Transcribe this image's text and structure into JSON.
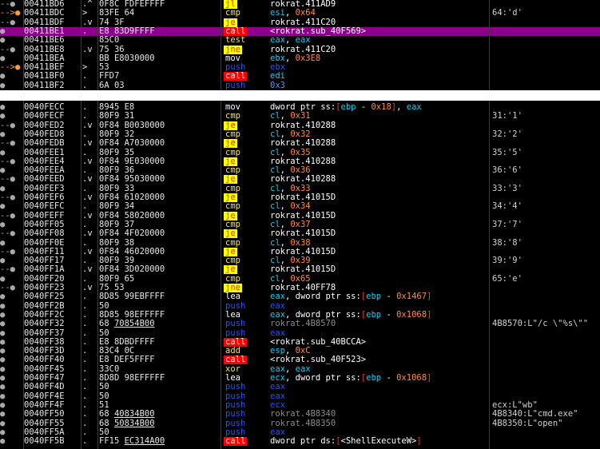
{
  "colors": {
    "call_bg": "#ff0000",
    "jcc_bg": "#ffff00",
    "push_fg": "#2255ff",
    "selected_bg": "#8b008b",
    "highlight_bg": "#00366b"
  },
  "top_rows": [
    {
      "mark": "--●",
      "addr": "00411BD6",
      "flag": ".^",
      "hex": "0F8C FDFEFFFF",
      "mn": "jl",
      "mn_style": "jcc",
      "op": "rokrat.411AD9",
      "comment": ""
    },
    {
      "mark": "-->●",
      "addr": "00411BDC",
      "flag": ">",
      "hex": "83FE 64",
      "mn": "cmp",
      "mn_style": "yellow",
      "op": "esi, 0x64",
      "comment": "64:'d'"
    },
    {
      "mark": "--●",
      "addr": "00411BDF",
      "flag": ".v",
      "hex": "74 3F",
      "mn": "je",
      "mn_style": "jcc",
      "op": "rokrat.411C20",
      "comment": ""
    },
    {
      "mark": "●",
      "addr": "00411BE1",
      "flag": ".",
      "hex": "E8 83D9FFFF",
      "mn": "call",
      "mn_style": "call",
      "op": "<rokrat.sub_40F569>",
      "comment": "",
      "row": "sel"
    },
    {
      "mark": "●",
      "addr": "00411BE6",
      "flag": "",
      "hex": "85C0",
      "mn": "test",
      "mn_style": "yellow",
      "op": "eax, eax",
      "comment": ""
    },
    {
      "mark": "--●",
      "addr": "00411BE8",
      "flag": ".v",
      "hex": "75 36",
      "mn": "jne",
      "mn_style": "jcc",
      "op": "rokrat.411C20",
      "comment": ""
    },
    {
      "mark": "●",
      "addr": "00411BEA",
      "flag": "",
      "hex": "BB E8030000",
      "mn": "mov",
      "mn_style": "plain",
      "op": "ebx, 0x3E8",
      "comment": ""
    },
    {
      "mark": "-->●",
      "addr": "00411BEF",
      "flag": ">",
      "hex": "53",
      "mn": "push",
      "mn_style": "push",
      "op": "ebx",
      "comment": ""
    },
    {
      "mark": "●",
      "addr": "00411BF0",
      "flag": ".",
      "hex": "FFD7",
      "mn": "call",
      "mn_style": "call",
      "op": "edi",
      "comment": ""
    },
    {
      "mark": "●",
      "addr": "00411BF2",
      "flag": ".",
      "hex": "6A 03",
      "mn": "push",
      "mn_style": "push",
      "op": "0x3",
      "comment": ""
    }
  ],
  "bottom_rows": [
    {
      "mark": "●",
      "addr": "0040FECC",
      "flag": ".",
      "hex": "8945 E8",
      "mn": "mov",
      "mn_style": "plain",
      "op": "dword ptr ss:[ebp - 0x18], eax",
      "comment": ""
    },
    {
      "mark": "●",
      "addr": "0040FECF",
      "flag": ".",
      "hex": "80F9 31",
      "mn": "cmp",
      "mn_style": "yellow",
      "op": "cl, 0x31",
      "comment": "31:'1'"
    },
    {
      "mark": "--●",
      "addr": "0040FED2",
      "flag": ".v",
      "hex": "0F84 B0030000",
      "mn": "je",
      "mn_style": "jcc",
      "op": "rokrat.410288",
      "comment": ""
    },
    {
      "mark": "●",
      "addr": "0040FED8",
      "flag": ".",
      "hex": "80F9 32",
      "mn": "cmp",
      "mn_style": "yellow",
      "op": "cl, 0x32",
      "comment": "32:'2'"
    },
    {
      "mark": "--●",
      "addr": "0040FEDB",
      "flag": ".v",
      "hex": "0F84 A7030000",
      "mn": "je",
      "mn_style": "jcc",
      "op": "rokrat.410288",
      "comment": ""
    },
    {
      "mark": "●",
      "addr": "0040FEE1",
      "flag": ".",
      "hex": "80F9 35",
      "mn": "cmp",
      "mn_style": "yellow",
      "op": "cl, 0x35",
      "comment": "35:'5'"
    },
    {
      "mark": "--●",
      "addr": "0040FEE4",
      "flag": ".v",
      "hex": "0F84 9E030000",
      "mn": "je",
      "mn_style": "jcc",
      "op": "rokrat.410288",
      "comment": ""
    },
    {
      "mark": "●",
      "addr": "0040FEEA",
      "flag": ".",
      "hex": "80F9 36",
      "mn": "cmp",
      "mn_style": "yellow",
      "op": "cl, 0x36",
      "comment": "36:'6'"
    },
    {
      "mark": "--●",
      "addr": "0040FEED",
      "flag": ".v",
      "hex": "0F84 95030000",
      "mn": "je",
      "mn_style": "jcc",
      "op": "rokrat.410288",
      "comment": ""
    },
    {
      "mark": "●",
      "addr": "0040FEF3",
      "flag": ".",
      "hex": "80F9 33",
      "mn": "cmp",
      "mn_style": "yellow",
      "op": "cl, 0x33",
      "comment": "33:'3'"
    },
    {
      "mark": "--●",
      "addr": "0040FEF6",
      "flag": ".v",
      "hex": "0F84 61020000",
      "mn": "je",
      "mn_style": "jcc",
      "op": "rokrat.41015D",
      "comment": ""
    },
    {
      "mark": "●",
      "addr": "0040FEFC",
      "flag": ".",
      "hex": "80F9 34",
      "mn": "cmp",
      "mn_style": "yellow",
      "op": "cl, 0x34",
      "comment": "34:'4'"
    },
    {
      "mark": "--●",
      "addr": "0040FEFF",
      "flag": ".v",
      "hex": "0F84 58020000",
      "mn": "je",
      "mn_style": "jcc",
      "op": "rokrat.41015D",
      "comment": ""
    },
    {
      "mark": "●",
      "addr": "0040FF05",
      "flag": ".",
      "hex": "80F9 37",
      "mn": "cmp",
      "mn_style": "yellow",
      "op": "cl, 0x37",
      "comment": "37:'7'"
    },
    {
      "mark": "--●",
      "addr": "0040FF08",
      "flag": ".v",
      "hex": "0F84 4F020000",
      "mn": "je",
      "mn_style": "jcc",
      "op": "rokrat.41015D",
      "comment": ""
    },
    {
      "mark": "●",
      "addr": "0040FF0E",
      "flag": ".",
      "hex": "80F9 38",
      "mn": "cmp",
      "mn_style": "yellow",
      "op": "cl, 0x38",
      "comment": "38:'8'"
    },
    {
      "mark": "--●",
      "addr": "0040FF11",
      "flag": ".v",
      "hex": "0F84 46020000",
      "mn": "je",
      "mn_style": "jcc",
      "op": "rokrat.41015D",
      "comment": ""
    },
    {
      "mark": "●",
      "addr": "0040FF17",
      "flag": ".",
      "hex": "80F9 39",
      "mn": "cmp",
      "mn_style": "yellow",
      "op": "cl, 0x39",
      "comment": "39:'9'"
    },
    {
      "mark": "--●",
      "addr": "0040FF1A",
      "flag": ".v",
      "hex": "0F84 3D020000",
      "mn": "je",
      "mn_style": "jcc",
      "op": "rokrat.41015D",
      "comment": ""
    },
    {
      "mark": "●",
      "addr": "0040FF20",
      "flag": ".",
      "hex": "80F9 65",
      "mn": "cmp",
      "mn_style": "yellow",
      "op": "cl, 0x65",
      "comment": "65:'e'"
    },
    {
      "mark": "--●",
      "addr": "0040FF23",
      "flag": ".v",
      "hex": "75 53",
      "mn": "jne",
      "mn_style": "jcc",
      "op": "rokrat.40FF78",
      "comment": ""
    },
    {
      "mark": "●",
      "addr": "0040FF25",
      "flag": ".",
      "hex": "8D85 99EBFFFF",
      "mn": "lea",
      "mn_style": "plain",
      "op": "eax, dword ptr ss:[ebp - 0x1467]",
      "comment": ""
    },
    {
      "mark": "●",
      "addr": "0040FF2B",
      "flag": ".",
      "hex": "50",
      "mn": "push",
      "mn_style": "push",
      "op": "eax",
      "comment": ""
    },
    {
      "mark": "●",
      "addr": "0040FF2C",
      "flag": ".",
      "hex": "8D85 98EFFFFF",
      "mn": "lea",
      "mn_style": "plain",
      "op": "eax, dword ptr ss:[ebp - 0x1068]",
      "comment": ""
    },
    {
      "mark": "●",
      "addr": "0040FF32",
      "flag": ".",
      "hex": "68 70854B00",
      "mn": "push",
      "mn_style": "push",
      "op": "rokrat.4B8570",
      "comment": "4B8570:L\"/c \\\"%s\\\"\"",
      "hex_under": "70854B00"
    },
    {
      "mark": "●",
      "addr": "0040FF37",
      "flag": ".",
      "hex": "50",
      "mn": "push",
      "mn_style": "push",
      "op": "eax",
      "comment": ""
    },
    {
      "mark": "●",
      "addr": "0040FF38",
      "flag": ".",
      "hex": "E8 8DBDFFFF",
      "mn": "call",
      "mn_style": "call",
      "op": "<rokrat.sub_40BCCA>",
      "comment": ""
    },
    {
      "mark": "●",
      "addr": "0040FF3D",
      "flag": ".",
      "hex": "83C4 0C",
      "mn": "add",
      "mn_style": "yellow",
      "op": "esp, 0xC",
      "comment": ""
    },
    {
      "mark": "●",
      "addr": "0040FF40",
      "flag": ".",
      "hex": "E8 DEF5FFFF",
      "mn": "call",
      "mn_style": "call",
      "op": "<rokrat.sub_40F523>",
      "comment": ""
    },
    {
      "mark": "●",
      "addr": "0040FF45",
      "flag": ".",
      "hex": "33C0",
      "mn": "xor",
      "mn_style": "yellow",
      "op": "eax, eax",
      "comment": ""
    },
    {
      "mark": "●",
      "addr": "0040FF47",
      "flag": ".",
      "hex": "8D8D 98EFFFFF",
      "mn": "lea",
      "mn_style": "plain",
      "op": "ecx, dword ptr ss:[ebp - 0x1068]",
      "comment": ""
    },
    {
      "mark": "●",
      "addr": "0040FF4D",
      "flag": ".",
      "hex": "50",
      "mn": "push",
      "mn_style": "push",
      "op": "eax",
      "comment": ""
    },
    {
      "mark": "●",
      "addr": "0040FF4E",
      "flag": ".",
      "hex": "50",
      "mn": "push",
      "mn_style": "push",
      "op": "eax",
      "comment": ""
    },
    {
      "mark": "●",
      "addr": "0040FF4F",
      "flag": ".",
      "hex": "51",
      "mn": "push",
      "mn_style": "push",
      "op": "ecx",
      "comment": "ecx:L\"wb\""
    },
    {
      "mark": "●",
      "addr": "0040FF50",
      "flag": ".",
      "hex": "68 40834B00",
      "mn": "push",
      "mn_style": "push",
      "op": "rokrat.4B8340",
      "comment": "4B8340:L\"cmd.exe\"",
      "hex_under": "40834B00"
    },
    {
      "mark": "●",
      "addr": "0040FF55",
      "flag": ".",
      "hex": "68 50834B00",
      "mn": "push",
      "mn_style": "push",
      "op": "rokrat.4B8350",
      "comment": "4B8350:L\"open\"",
      "hex_under": "50834B00"
    },
    {
      "mark": "●",
      "addr": "0040FF5A",
      "flag": ".",
      "hex": "50",
      "mn": "push",
      "mn_style": "push",
      "op": "eax",
      "comment": ""
    },
    {
      "mark": "●",
      "addr": "0040FF5B",
      "flag": ".",
      "hex": "FF15 EC314A00",
      "mn": "call",
      "mn_style": "call",
      "op": "dword ptr ds:[<ShellExecuteW>]",
      "comment": "",
      "hex_under": "EC314A00"
    }
  ]
}
